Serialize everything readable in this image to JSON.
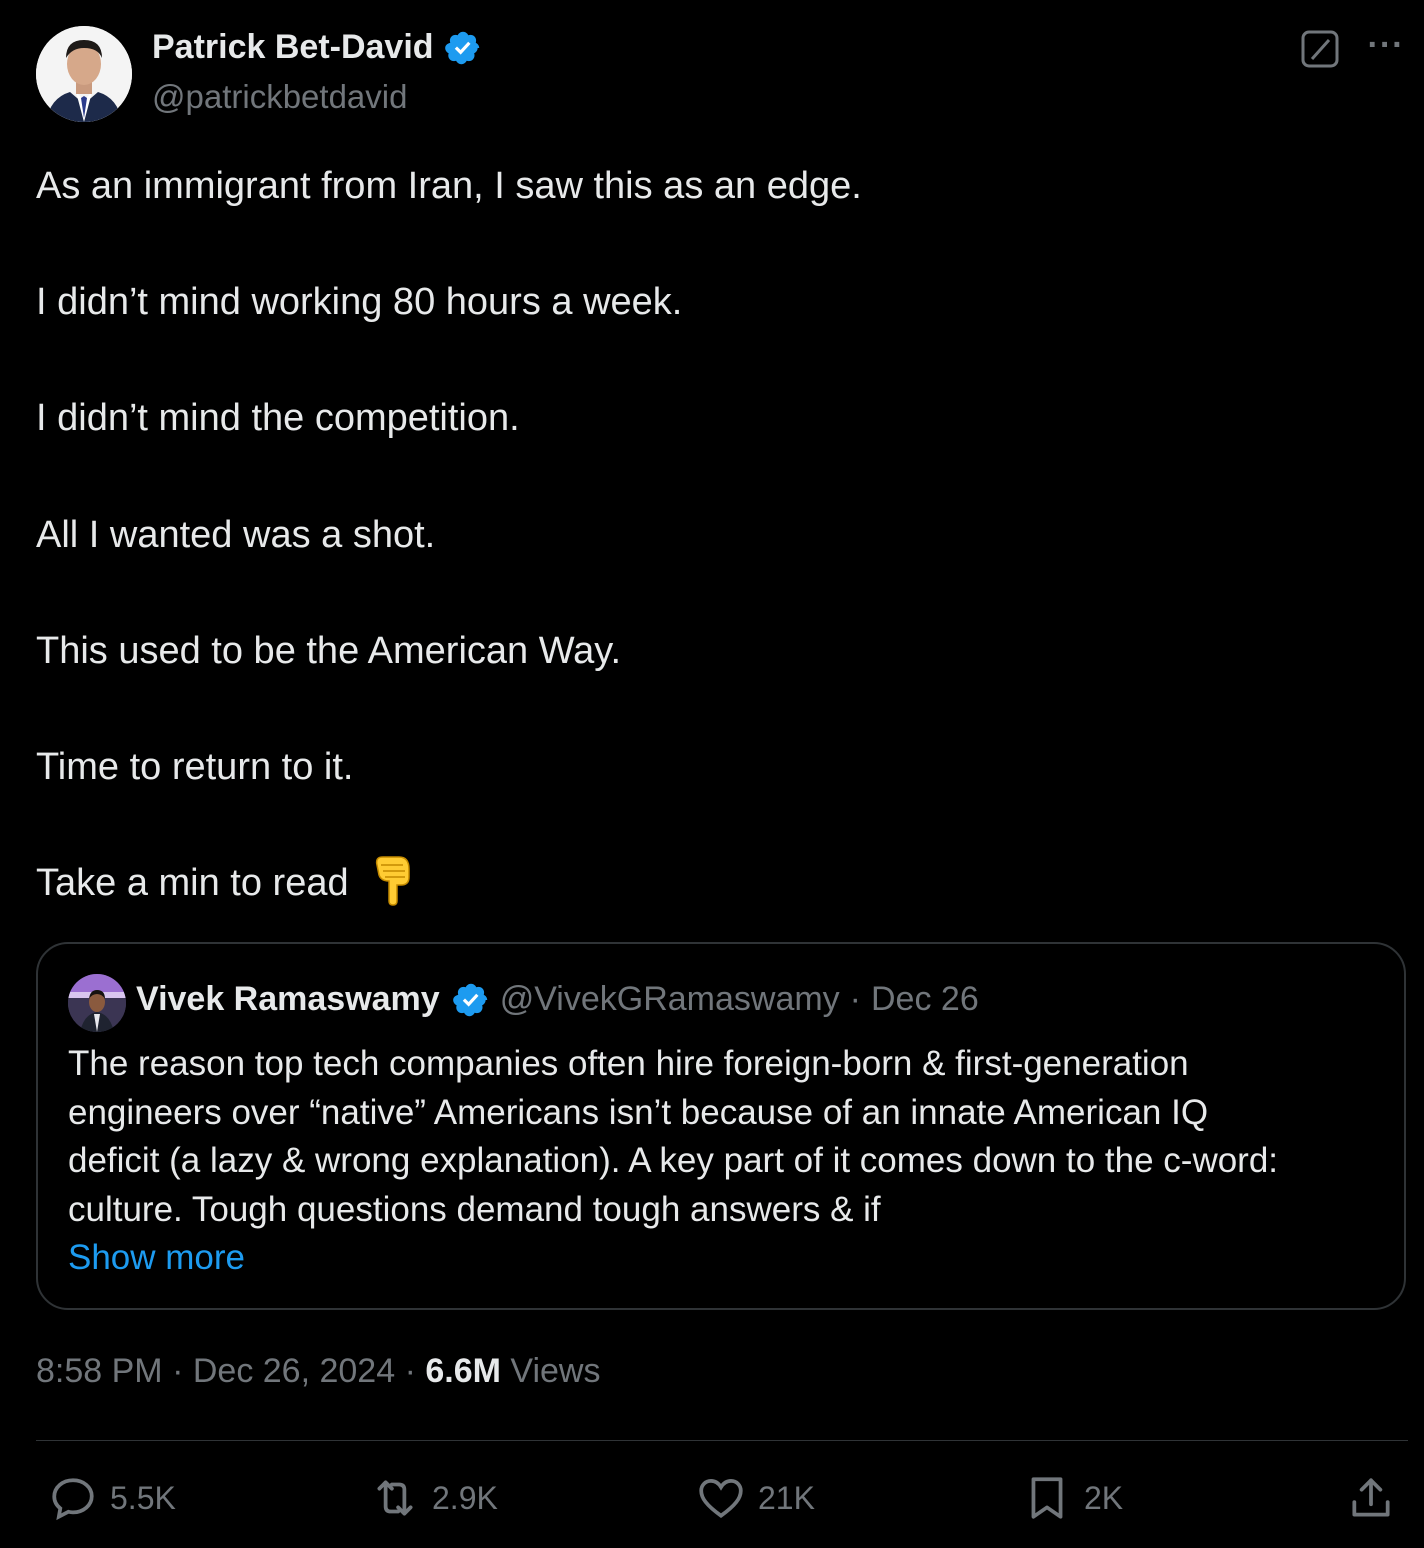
{
  "author": {
    "name": "Patrick Bet-David",
    "handle": "@patrickbetdavid",
    "verified": true
  },
  "tweet": {
    "lines": [
      "As an immigrant from Iran, I saw this as an edge.",
      "I didn’t mind working 80 hours a week.",
      "I didn’t mind the competition.",
      "All I wanted was a shot.",
      "This used to be the American Way.",
      "Time to return to it.",
      "Take a min to read"
    ],
    "emoji": "👇"
  },
  "quote": {
    "name": "Vivek Ramaswamy",
    "handle": "@VivekGRamaswamy",
    "separator": "·",
    "date": "Dec 26",
    "text_lines": [
      "The reason top tech companies often hire foreign-born & first-generation",
      "engineers over “native” Americans isn’t because of an innate American IQ",
      "deficit (a lazy & wrong explanation). A key part of it comes down to the c-word:",
      "culture. Tough questions demand tough answers & if"
    ],
    "show_more": "Show more"
  },
  "meta": {
    "time": "8:58 PM",
    "sep1": "·",
    "date": "Dec 26, 2024",
    "sep2": "·",
    "views_count": "6.6M",
    "views_label": "Views"
  },
  "actions": {
    "replies": "5.5K",
    "reposts": "2.9K",
    "likes": "21K",
    "bookmarks": "2K"
  },
  "colors": {
    "background": "#000000",
    "text": "#e7e9ea",
    "muted": "#71767b",
    "accent": "#1d9bf0",
    "border": "#2f3336"
  },
  "icons": [
    "verified-badge-icon",
    "grok-icon",
    "more-icon",
    "reply-icon",
    "repost-icon",
    "like-icon",
    "bookmark-icon",
    "share-icon"
  ]
}
